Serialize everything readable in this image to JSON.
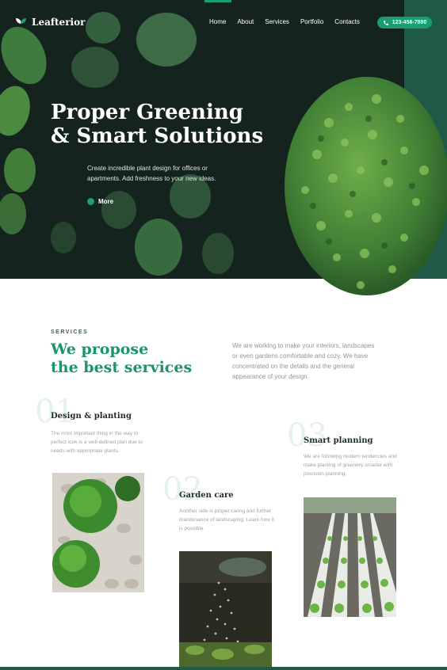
{
  "header": {
    "logo_text": "Leafterior",
    "nav": [
      "Home",
      "About",
      "Services",
      "Portfolio",
      "Contacts"
    ],
    "phone": "123-456-7890"
  },
  "hero": {
    "title_line1": "Proper Greening",
    "title_line2": "& Smart Solutions",
    "subtitle": "Create incredible plant design for offices or apartments. Add freshness to your new ideas.",
    "cta": "More"
  },
  "services": {
    "label": "SERVICES",
    "heading_line1": "We propose",
    "heading_line2": "the best services",
    "description": "We are working to make your interiors, landscapes or even gardens comfortable and cozy. We have concentrated on the details and the general appearance of your design.",
    "items": [
      {
        "number": "01",
        "title": "Design & planting",
        "text": "The most important thing in the way to perfect look is a well-defined plan due to needs with appropriate plants."
      },
      {
        "number": "02",
        "title": "Garden care",
        "text": "Another side is proper caring and further maintenance of landscaping. Learn how it is possible."
      },
      {
        "number": "03",
        "title": "Smart planning",
        "text": "We are following modern tendencies and make planting of greenery smarter with precision planning."
      }
    ]
  },
  "colors": {
    "accent": "#1b9c72",
    "hero_bg": "#15231f",
    "teal_strip": "#1f5a49"
  }
}
